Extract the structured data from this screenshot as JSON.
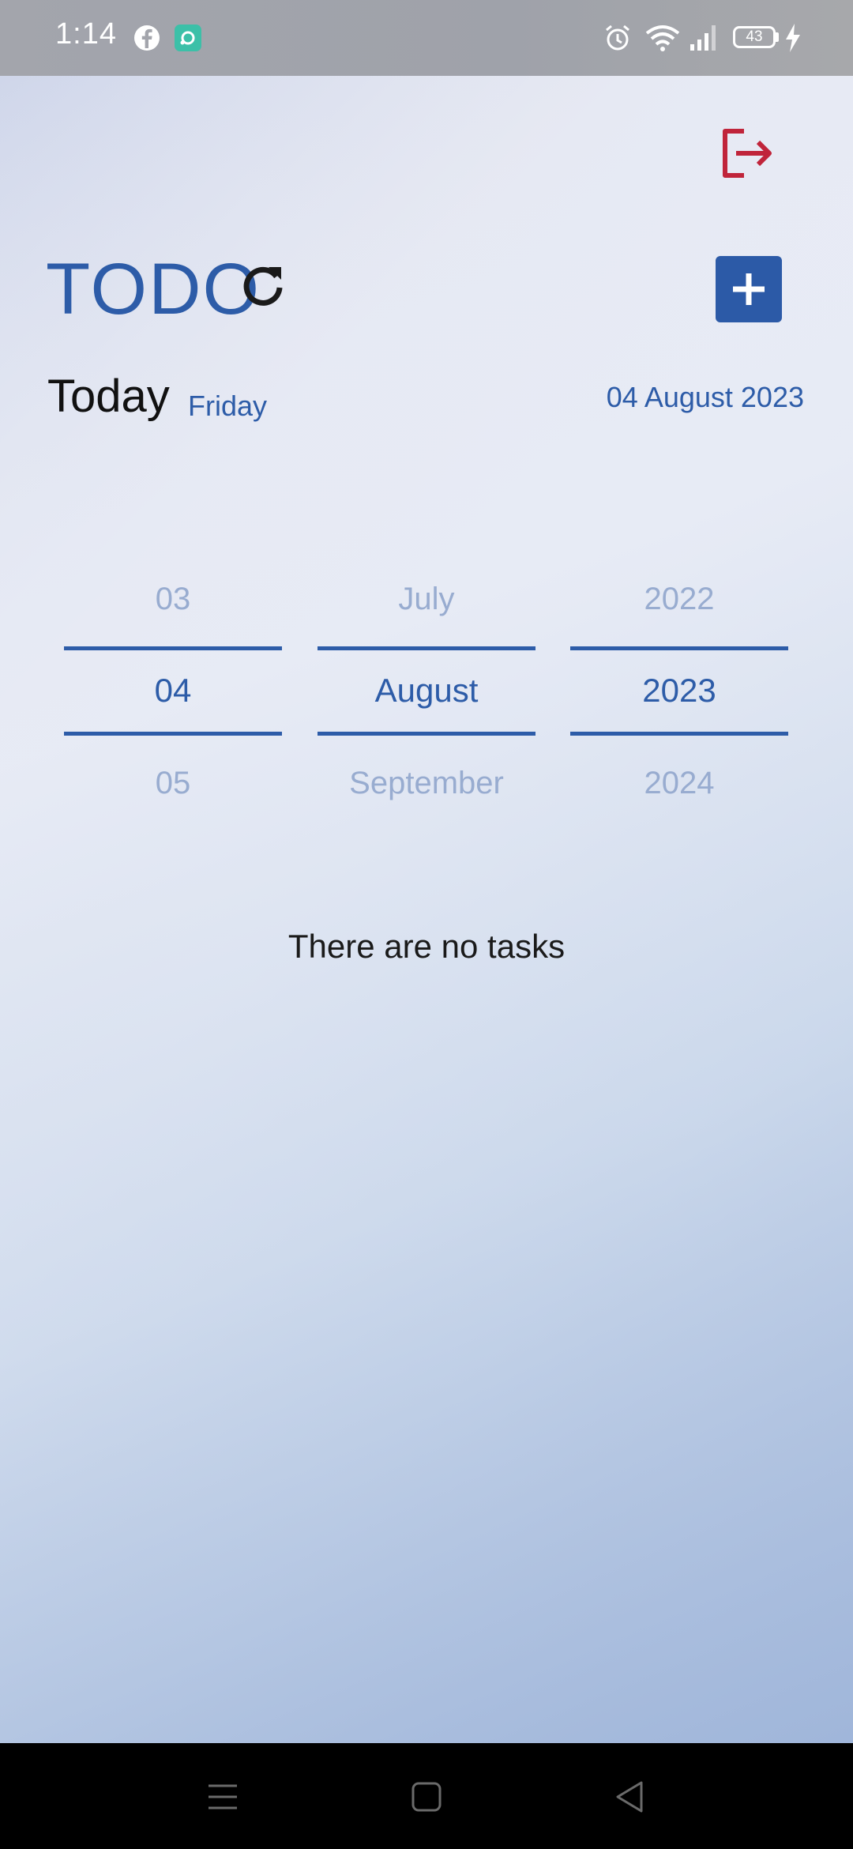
{
  "status_bar": {
    "time": "1:14",
    "battery_level": "43",
    "icons": [
      "facebook-icon",
      "app-notification-icon",
      "alarm-icon",
      "wifi-icon",
      "signal-icon",
      "battery-icon",
      "charging-icon"
    ]
  },
  "header": {
    "title": "TODO",
    "refresh_icon": "refresh-icon",
    "add_icon": "plus-icon",
    "logout_icon": "logout-icon"
  },
  "today": {
    "label": "Today",
    "weekday": "Friday",
    "date": "04 August 2023"
  },
  "date_picker": {
    "day": {
      "prev": "03",
      "selected": "04",
      "next": "05"
    },
    "month": {
      "prev": "July",
      "selected": "August",
      "next": "September"
    },
    "year": {
      "prev": "2022",
      "selected": "2023",
      "next": "2024"
    }
  },
  "tasks": {
    "empty_message": "There are no tasks"
  },
  "nav_bar": {
    "icons": [
      "menu-icon",
      "home-icon",
      "back-icon"
    ]
  },
  "colors": {
    "accent": "#2d5ca8",
    "logout": "#c0243a",
    "picker_faded": "#98acd0"
  }
}
